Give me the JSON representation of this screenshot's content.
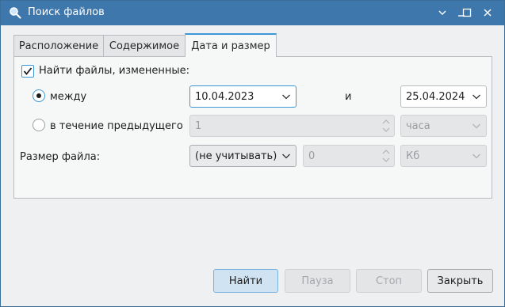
{
  "window": {
    "title": "Поиск файлов"
  },
  "tabs": [
    {
      "label": "Расположение",
      "active": false
    },
    {
      "label": "Содержимое",
      "active": false
    },
    {
      "label": "Дата и размер",
      "active": true
    }
  ],
  "date_filter": {
    "checkbox_label": "Найти файлы, измененные:",
    "checked": true,
    "between": {
      "label": "между",
      "selected": true,
      "from": "10.04.2023",
      "and_label": "и",
      "to": "25.04.2024"
    },
    "within": {
      "label": "в течение предыдущего",
      "selected": false,
      "amount": "1",
      "unit": "часа"
    }
  },
  "size_filter": {
    "label": "Размер файла:",
    "mode": "(не учитывать)",
    "amount": "0",
    "unit": "Кб"
  },
  "buttons": {
    "find": "Найти",
    "pause": "Пауза",
    "stop": "Стоп",
    "close": "Закрыть"
  },
  "colors": {
    "titlebar": "#3d77ab",
    "accent": "#3d97d6",
    "default_button": "#cfe3f3"
  }
}
